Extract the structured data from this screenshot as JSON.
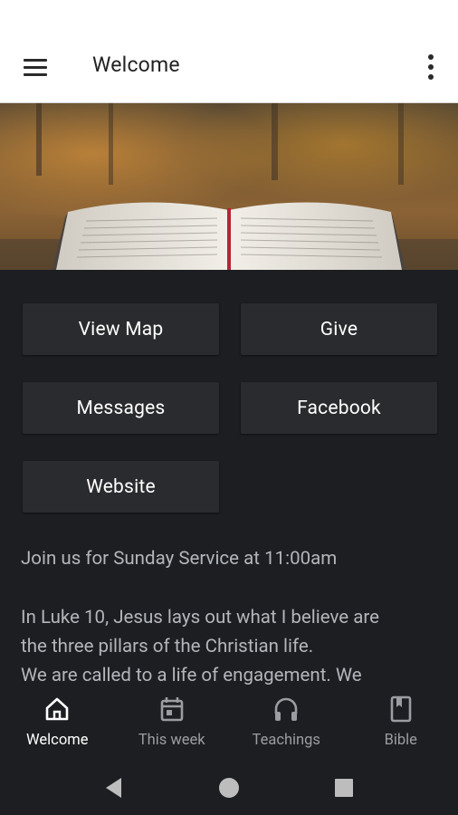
{
  "app_bar": {
    "title": "Welcome",
    "menu_icon": "hamburger-menu-icon",
    "overflow_icon": "more-vert-icon"
  },
  "hero": {
    "image": "open-bible-autumn-photo"
  },
  "buttons": {
    "view_map": "View Map",
    "give": "Give",
    "messages": "Messages",
    "facebook": "Facebook",
    "website": "Website"
  },
  "info": {
    "service_text": "Join us for Sunday Service at 11:00am",
    "message_lines": [
      "In Luke 10, Jesus lays out what I believe are",
      "the three pillars of the Christian life.",
      "We are called to a life of engagement. We"
    ]
  },
  "bottom_nav": [
    {
      "label": "Welcome",
      "icon": "home-icon",
      "active": true
    },
    {
      "label": "This week",
      "icon": "calendar-icon",
      "active": false
    },
    {
      "label": "Teachings",
      "icon": "headphones-icon",
      "active": false
    },
    {
      "label": "Bible",
      "icon": "bookmark-book-icon",
      "active": false
    }
  ],
  "system_nav": {
    "back": "back-icon",
    "home": "home-circle-icon",
    "recents": "recents-icon"
  },
  "colors": {
    "background": "#1c1e21",
    "button": "#2a2b2e",
    "text_muted": "#b3b6bb",
    "app_bar": "#ffffff"
  }
}
